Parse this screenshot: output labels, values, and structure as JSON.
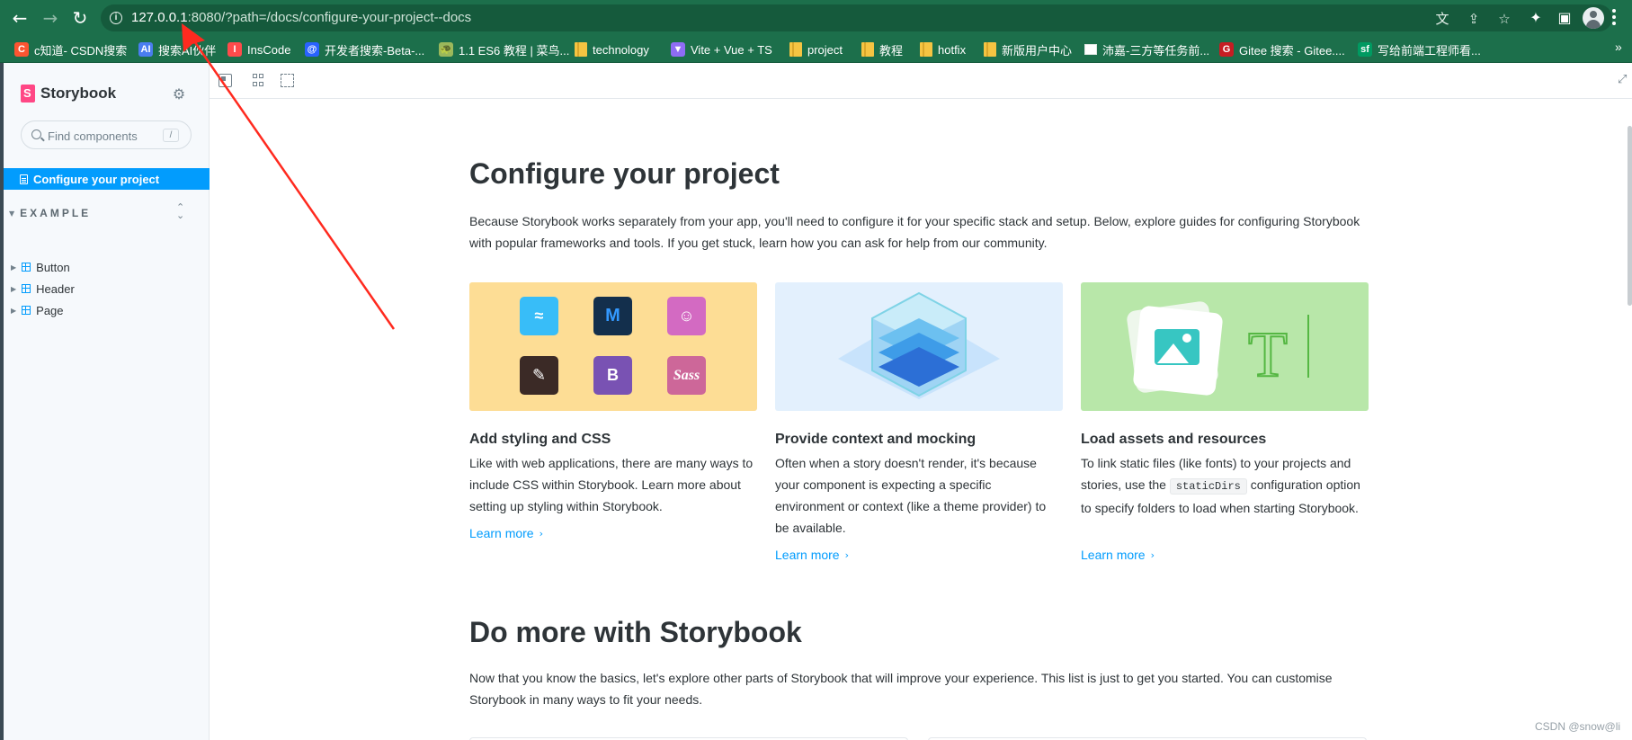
{
  "browser": {
    "nav": {
      "back": "←",
      "forward": "→",
      "reload": "↻"
    },
    "url_host": "127.0.0.1",
    "url_port_path": ":8080/?path=/docs/configure-your-project--docs",
    "omnibox_icons": [
      "translate-icon",
      "share-icon",
      "star-icon"
    ],
    "toolbar_icons": [
      "extensions-icon",
      "side-panel-icon",
      "profile-icon",
      "menu-icon"
    ]
  },
  "bookmarks": [
    {
      "label": "c知道- CSDN搜索",
      "icon": "C",
      "color": "#fc5531"
    },
    {
      "label": "搜索AI伙伴",
      "icon": "AI",
      "color": "#4a7df0"
    },
    {
      "label": "InsCode",
      "icon": "I",
      "color": "#ff4b4b"
    },
    {
      "label": "开发者搜索-Beta-...",
      "icon": "@",
      "color": "#2962ff"
    },
    {
      "label": "1.1 ES6 教程 | 菜鸟...",
      "icon": "🐢",
      "color": "#9bb85b"
    },
    {
      "label": "technology",
      "icon": "folder"
    },
    {
      "label": "Vite + Vue + TS",
      "icon": "▼",
      "color": "#8e6cf5"
    },
    {
      "label": "project",
      "icon": "folder"
    },
    {
      "label": "教程",
      "icon": "folder"
    },
    {
      "label": "hotfix",
      "icon": "folder"
    },
    {
      "label": "新版用户中心",
      "icon": "folder"
    },
    {
      "label": "沛嘉-三方等任务前...",
      "icon": "doc"
    },
    {
      "label": "Gitee 搜索 - Gitee....",
      "icon": "G",
      "color": "#c71d23"
    },
    {
      "label": "写给前端工程师看...",
      "icon": "sf",
      "color": "#009a61"
    }
  ],
  "bookmarks_more": "»",
  "sidebar": {
    "brand": "Storybook",
    "search_placeholder": "Find components",
    "search_shortcut": "/",
    "active_item": "Configure your project",
    "group_label": "EXAMPLE",
    "items": [
      "Button",
      "Header",
      "Page"
    ]
  },
  "doc": {
    "title": "Configure your project",
    "intro": "Because Storybook works separately from your app, you'll need to configure it for your specific stack and setup. Below, explore guides for configuring Storybook with popular frameworks and tools. If you get stuck, learn how you can ask for help from our community.",
    "cards": [
      {
        "title": "Add styling and CSS",
        "desc": "Like with web applications, there are many ways to include CSS within Storybook. Learn more about setting up styling within Storybook.",
        "link": "Learn more",
        "color": "#fddd95"
      },
      {
        "title": "Provide context and mocking",
        "desc": "Often when a story doesn't render, it's because your component is expecting a specific environment or context (like a theme provider) to be available.",
        "link": "Learn more",
        "color": "#e3f0fd"
      },
      {
        "title": "Load assets and resources",
        "desc_before": "To link static files (like fonts) to your projects and stories, use the ",
        "desc_code": "staticDirs",
        "desc_after": " configuration option to specify folders to load when starting Storybook.",
        "link": "Learn more",
        "color": "#b8e7a9"
      }
    ],
    "logo_tiles": [
      {
        "name": "tailwind-logo-icon",
        "glyph": "≈"
      },
      {
        "name": "mui-logo-icon",
        "glyph": "M"
      },
      {
        "name": "emotion-logo-icon",
        "glyph": "☺"
      },
      {
        "name": "styled-components-logo-icon",
        "glyph": "✎"
      },
      {
        "name": "bootstrap-logo-icon",
        "glyph": "B"
      },
      {
        "name": "sass-logo-icon",
        "glyph": "Sass"
      }
    ],
    "title2": "Do more with Storybook",
    "intro2": "Now that you know the basics, let's explore other parts of Storybook that will improve your experience. This list is just to get you started. You can customise Storybook in many ways to fit your needs."
  },
  "watermark": "CSDN @snow@li",
  "colors": {
    "browser_chrome": "#1c6f4b",
    "storybook_accent": "#029cfd",
    "storybook_brand": "#ff4785",
    "annotation_arrow": "#ff2a1f"
  }
}
